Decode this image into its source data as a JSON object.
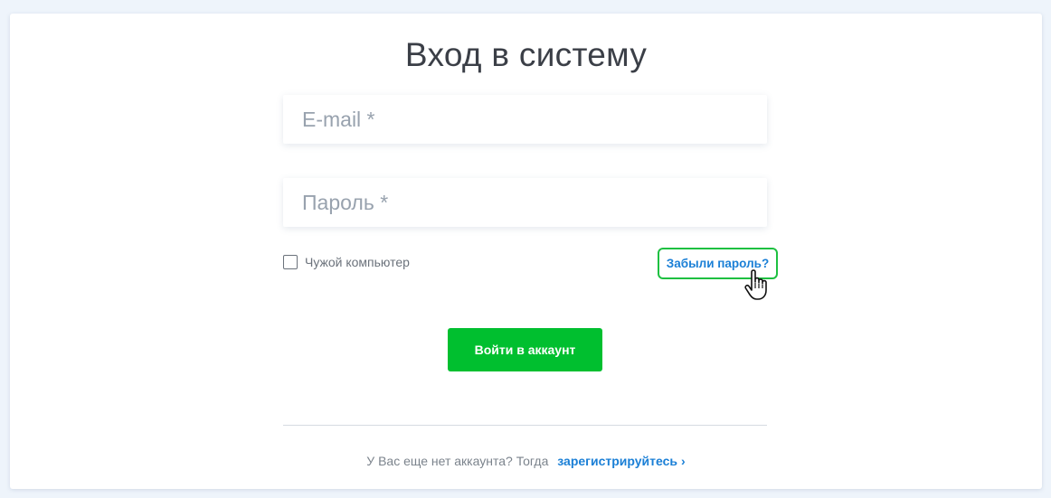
{
  "page": {
    "title": "Вход в систему"
  },
  "form": {
    "email_placeholder": "E-mail *",
    "email_value": "",
    "password_placeholder": "Пароль *",
    "password_value": "",
    "remember_label": "Чужой компьютер",
    "remember_checked": false,
    "forgot_label": "Забыли пароль?",
    "submit_label": "Войти в аккаунт"
  },
  "footer": {
    "prompt_text": "У Вас еще нет аккаунта? Тогда",
    "register_label": "зарегистрируйтесь",
    "register_chevron": "›"
  },
  "colors": {
    "accent_green": "#00bf2f",
    "link_blue": "#1a7fd6",
    "highlight_green": "#1ec041"
  },
  "icons": {
    "cursor": "hand-pointer-icon",
    "chevron": "chevron-right-icon"
  }
}
